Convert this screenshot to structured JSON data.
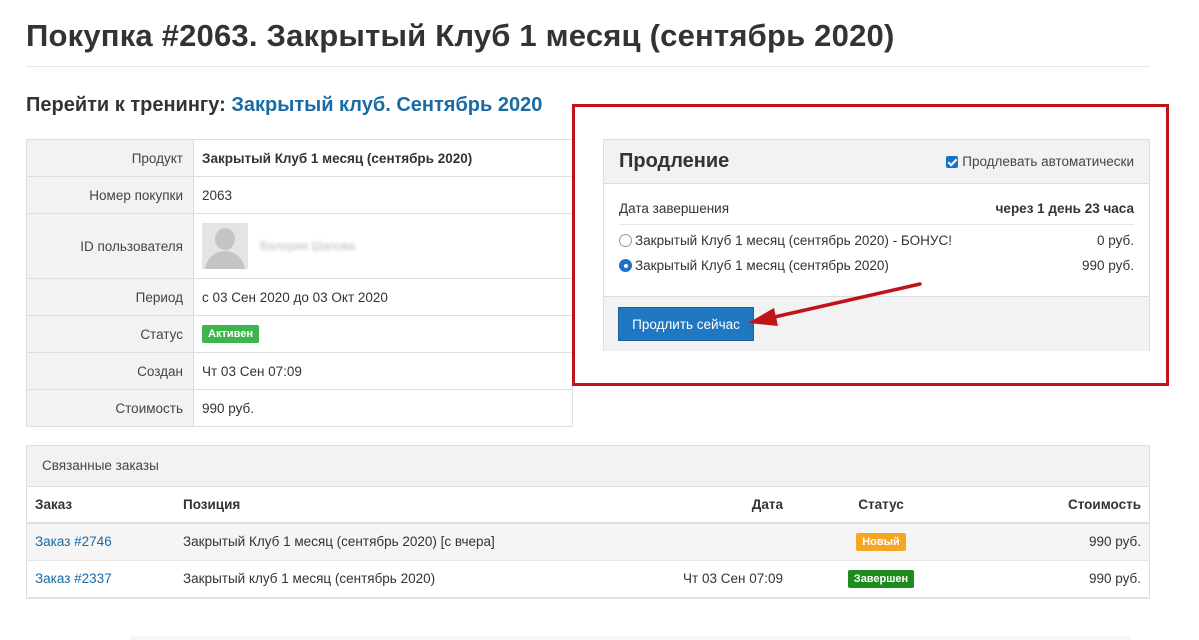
{
  "page": {
    "title": "Покупка #2063. Закрытый Клуб 1 месяц (сентябрь 2020)",
    "goto_label": "Перейти к тренингу:",
    "goto_link": "Закрытый клуб. Сентябрь 2020"
  },
  "info": {
    "product_label": "Продукт",
    "product_value": "Закрытый Клуб 1 месяц (сентябрь 2020)",
    "number_label": "Номер покупки",
    "number_value": "2063",
    "user_label": "ID пользователя",
    "user_value": "Валерия Шапова",
    "period_label": "Период",
    "period_value": "с 03 Сен 2020 до 03 Окт 2020",
    "status_label": "Статус",
    "status_value": "Активен",
    "created_label": "Создан",
    "created_value": "Чт 03 Сен 07:09",
    "cost_label": "Стоимость",
    "cost_value": "990 руб."
  },
  "renewal": {
    "title": "Продление",
    "auto_label": "Продлевать автоматически",
    "auto_checked": true,
    "end_label": "Дата завершения",
    "end_value": "через 1 день 23 часа",
    "options": [
      {
        "label": "Закрытый Клуб 1 месяц (сентябрь 2020) - БОНУС!",
        "price": "0 руб.",
        "selected": false
      },
      {
        "label": "Закрытый Клуб 1 месяц (сентябрь 2020)",
        "price": "990 руб.",
        "selected": true
      }
    ],
    "button_label": "Продлить сейчас"
  },
  "orders": {
    "heading": "Связанные заказы",
    "columns": [
      "Заказ",
      "Позиция",
      "Дата",
      "Статус",
      "Стоимость"
    ],
    "rows": [
      {
        "order": "Заказ #2746",
        "position": "Закрытый Клуб 1 месяц (сентябрь 2020) [с вчера]",
        "date": "",
        "status": "Новый",
        "cost": "990 руб."
      },
      {
        "order": "Заказ #2337",
        "position": "Закрытый клуб 1 месяц (сентябрь 2020)",
        "date": "Чт 03 Сен 07:09",
        "status": "Завершен",
        "cost": "990 руб."
      }
    ]
  },
  "colors": {
    "link": "#1a6aa4",
    "primary_button": "#1f78c1",
    "highlight": "#c0141a",
    "status_active": "#3cb54a",
    "status_new": "#f5a623",
    "status_done": "#1e8b1e"
  }
}
